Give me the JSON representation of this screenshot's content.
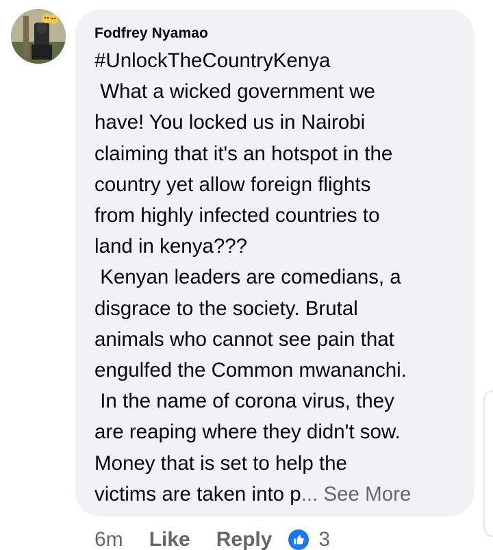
{
  "comment": {
    "author": "Fodfrey Nyamao",
    "hashtag": "#UnlockTheCountryKenya",
    "text": " What a wicked government we\nhave! You locked us in Nairobi\nclaiming that it's an hotspot in the\ncountry yet allow foreign flights\nfrom highly infected countries to\nland in kenya???\n Kenyan leaders are comedians, a\ndisgrace to the society. Brutal\nanimals who cannot see pain that\nengulfed the Common mwananchi.\n In the name of corona virus, they\nare reaping where they didn't sow.\nMoney that is set to help the\nvictims are taken into p",
    "ellipsis": "...",
    "see_more": " See More"
  },
  "actions": {
    "time": "6m",
    "like": "Like",
    "reply": "Reply",
    "reaction_count": "3",
    "reaction_icon": "thumbs-up-icon"
  },
  "colors": {
    "bubble_bg": "#f0f2f5",
    "muted_text": "#65676b",
    "like_blue": "#1877f2"
  }
}
